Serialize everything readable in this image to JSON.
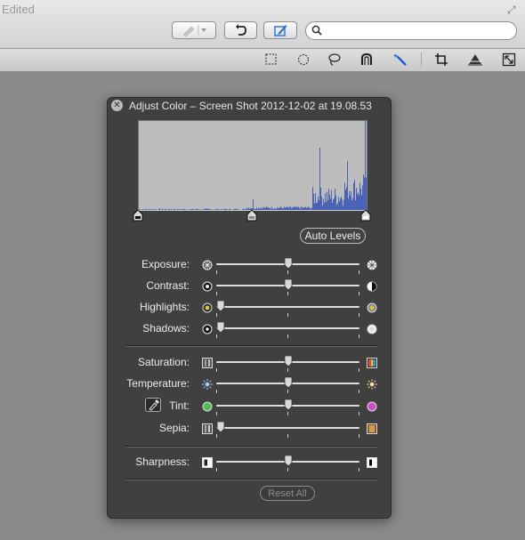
{
  "window": {
    "title": "Edited"
  },
  "search": {
    "placeholder": "",
    "value": ""
  },
  "panel": {
    "title": "Adjust Color – Screen Shot 2012-12-02 at 19.08.53",
    "auto_levels": "Auto Levels",
    "reset_all": "Reset All",
    "rows": [
      {
        "label": "Exposure:",
        "left_icon": "exposure-low-icon",
        "right_icon": "exposure-high-icon",
        "value": 0.5
      },
      {
        "label": "Contrast:",
        "left_icon": "contrast-low-icon",
        "right_icon": "contrast-high-icon",
        "value": 0.5
      },
      {
        "label": "Highlights:",
        "left_icon": "highlights-low-icon",
        "right_icon": "highlights-high-icon",
        "value": 0.0
      },
      {
        "label": "Shadows:",
        "left_icon": "shadows-low-icon",
        "right_icon": "shadows-high-icon",
        "value": 0.0
      },
      {
        "label": "Saturation:",
        "left_icon": "saturation-low-icon",
        "right_icon": "saturation-high-icon",
        "value": 0.5
      },
      {
        "label": "Temperature:",
        "left_icon": "temperature-cool-icon",
        "right_icon": "temperature-warm-icon",
        "value": 0.5
      },
      {
        "label": "Tint:",
        "left_icon": "tint-green-icon",
        "right_icon": "tint-magenta-icon",
        "value": 0.5
      },
      {
        "label": "Sepia:",
        "left_icon": "sepia-low-icon",
        "right_icon": "sepia-high-icon",
        "value": 0.0
      },
      {
        "label": "Sharpness:",
        "left_icon": "sharpness-low-icon",
        "right_icon": "sharpness-high-icon",
        "value": 0.5
      }
    ],
    "levels": {
      "black": 0.0,
      "mid": 0.5,
      "white": 1.0
    }
  },
  "colors": {
    "panel_bg": "#3c3c3c",
    "histogram_blue": "#4a63b5",
    "histogram_bg": "#bdbdbd"
  }
}
